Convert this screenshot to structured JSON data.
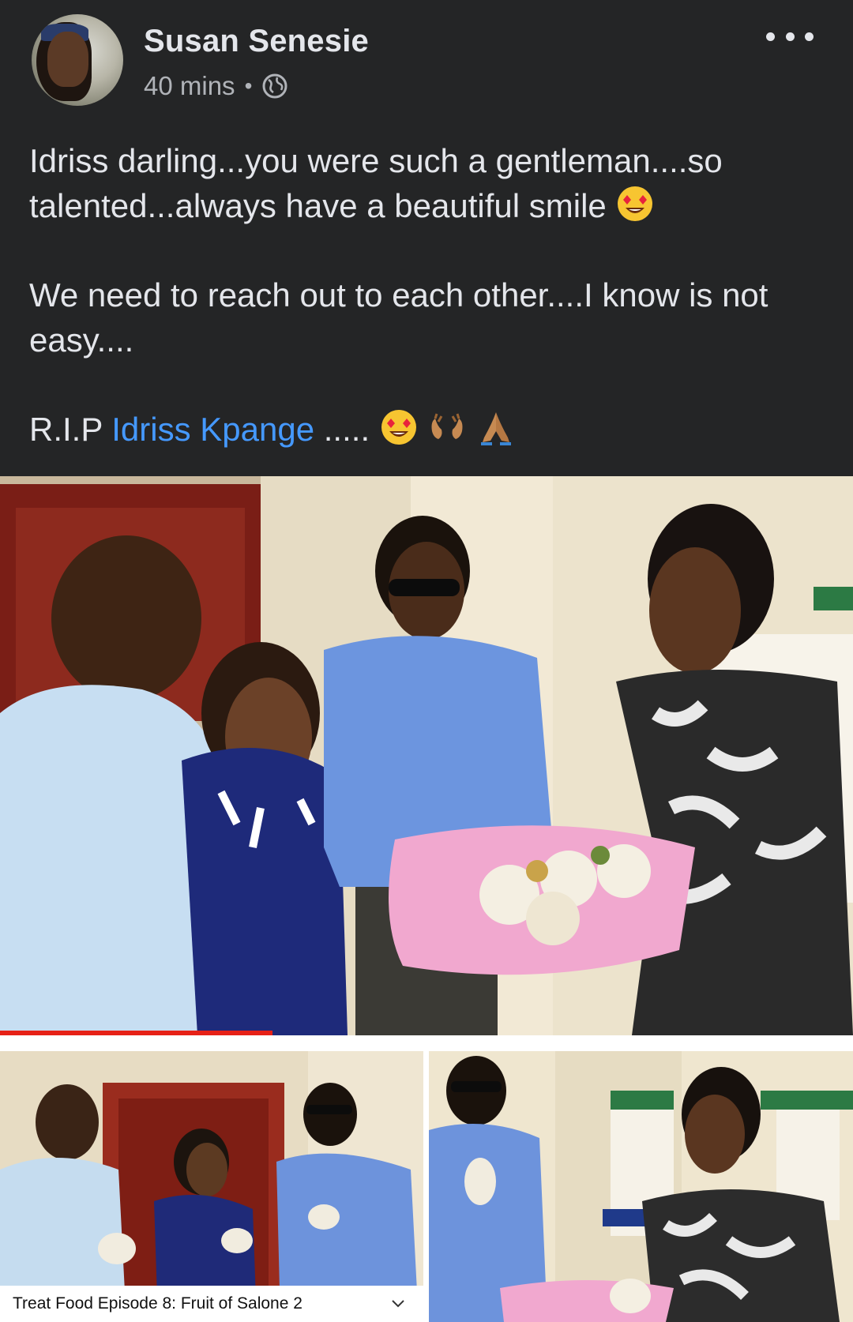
{
  "post": {
    "author": "Susan Senesie",
    "time": "40 mins",
    "separator": "•",
    "privacy_icon": "globe-icon",
    "more_icon": "more-horizontal-icon",
    "text": {
      "line1": "Idriss darling...you were such a gentleman....so talented...always have a beautiful smile",
      "line2": "We need to reach out to each other....I know is not easy....",
      "line3_prefix": "R.I.P",
      "line3_link": "Idriss Kpange",
      "line3_suffix": "....."
    },
    "emojis": [
      "heart-eyes-emoji",
      "heart-eyes-emoji",
      "open-hands-emoji",
      "folded-hands-emoji"
    ]
  },
  "media": {
    "main_photo": "photo-group-serving-food",
    "bottom_left": {
      "photo": "photo-video-frame-eating",
      "caption": "Treat Food Episode 8: Fruit of Salone 2",
      "progress": 0.0
    },
    "bottom_right": "photo-two-people-eating",
    "main_progress": 0.32
  },
  "colors": {
    "background": "#242526",
    "text": "#e4e6eb",
    "secondary_text": "#b0b3b8",
    "link": "#4599ff"
  }
}
